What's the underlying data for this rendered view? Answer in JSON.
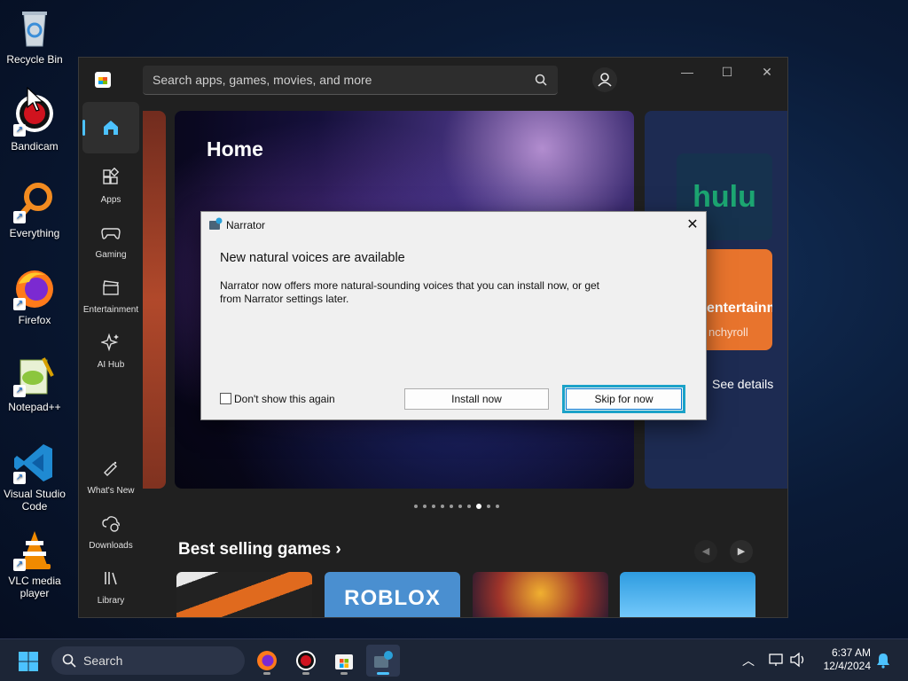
{
  "desktop": {
    "icons": [
      {
        "label": "Recycle Bin",
        "icon": "recycle-bin-icon"
      },
      {
        "label": "Bandicam",
        "icon": "bandicam-icon"
      },
      {
        "label": "Everything",
        "icon": "everything-search-icon"
      },
      {
        "label": "Firefox",
        "icon": "firefox-icon"
      },
      {
        "label": "Notepad++",
        "icon": "notepad-plus-plus-icon"
      },
      {
        "label": "Visual Studio Code",
        "icon": "vscode-icon"
      },
      {
        "label": "VLC media player",
        "icon": "vlc-icon"
      }
    ]
  },
  "store": {
    "search_placeholder": "Search apps, games, movies, and more",
    "nav": [
      {
        "label": "Home",
        "icon": "home-icon",
        "active": true
      },
      {
        "label": "Apps",
        "icon": "apps-icon"
      },
      {
        "label": "Gaming",
        "icon": "gamepad-icon"
      },
      {
        "label": "Entertainment",
        "icon": "clapperboard-icon"
      },
      {
        "label": "AI Hub",
        "icon": "sparkle-icon"
      },
      {
        "label": "What's New",
        "icon": "megaphone-icon"
      },
      {
        "label": "Downloads",
        "icon": "download-cloud-icon"
      },
      {
        "label": "Library",
        "icon": "library-icon"
      }
    ],
    "hero_title": "Home",
    "side_tiles": {
      "hulu": "hulu",
      "crunchyroll_title": "entertainme",
      "crunchyroll_sub": "nchyroll",
      "see_details": "See details"
    },
    "carousel": {
      "count": 10,
      "active_index": 7
    },
    "best_selling": "Best selling games",
    "games": [
      {
        "name": "",
        "color": "#e06a1e"
      },
      {
        "name": "ROBLOX",
        "color": "#4a8fd0"
      },
      {
        "name": "",
        "color": "#a0342a"
      },
      {
        "name": "",
        "color": "#2e9ce0"
      }
    ]
  },
  "dialog": {
    "title": "Narrator",
    "heading": "New natural voices are available",
    "body": "Narrator now offers more natural-sounding voices that you can install now, or get from Narrator settings later.",
    "checkbox_label": "Don't show this again",
    "install_label": "Install now",
    "skip_label": "Skip for now"
  },
  "taskbar": {
    "search_label": "Search",
    "time": "6:37 AM",
    "date": "12/4/2024"
  }
}
